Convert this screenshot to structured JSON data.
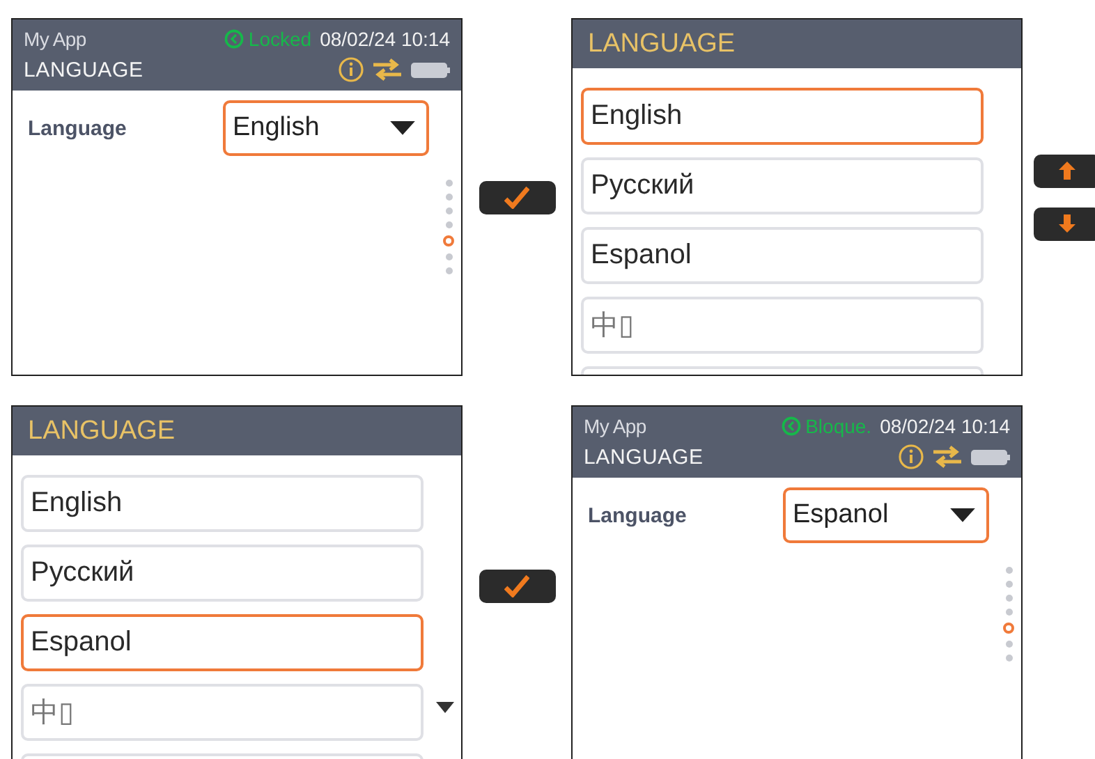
{
  "rows": [
    {
      "panels": [
        {
          "kind": "settings",
          "header": {
            "app": "My App",
            "lock_status": "Locked",
            "datetime": "08/02/24 10:14",
            "title": "LANGUAGE"
          },
          "field": {
            "label": "Language",
            "value": "English"
          },
          "page_dots": [
            {
              "selected": false
            },
            {
              "selected": false
            },
            {
              "selected": false
            },
            {
              "selected": false
            },
            {
              "selected": true
            },
            {
              "selected": false
            },
            {
              "selected": false
            }
          ],
          "buttons": [
            {
              "kind": "confirm"
            }
          ]
        },
        {
          "kind": "list",
          "title": "LANGUAGE",
          "options": [
            {
              "label": "English",
              "selected": true
            },
            {
              "label": "Русский",
              "selected": false
            },
            {
              "label": "Espanol",
              "selected": false
            },
            {
              "label": "中▯",
              "selected": false
            }
          ],
          "scroll_more": false,
          "buttons": [
            {
              "kind": "up"
            },
            {
              "kind": "down"
            }
          ]
        }
      ]
    },
    {
      "panels": [
        {
          "kind": "list",
          "title": "LANGUAGE",
          "options": [
            {
              "label": "English",
              "selected": false
            },
            {
              "label": "Русский",
              "selected": false
            },
            {
              "label": "Espanol",
              "selected": true
            },
            {
              "label": "中▯",
              "selected": false
            }
          ],
          "scroll_more": true,
          "buttons": [
            {
              "kind": "confirm"
            }
          ]
        },
        {
          "kind": "settings",
          "header": {
            "app": "My App",
            "lock_status": "Bloque.",
            "datetime": "08/02/24 10:14",
            "title": "LANGUAGE"
          },
          "field": {
            "label": "Language",
            "value": "Espanol"
          },
          "page_dots": [
            {
              "selected": false
            },
            {
              "selected": false
            },
            {
              "selected": false
            },
            {
              "selected": false
            },
            {
              "selected": true
            },
            {
              "selected": false
            },
            {
              "selected": false
            }
          ]
        }
      ]
    }
  ]
}
